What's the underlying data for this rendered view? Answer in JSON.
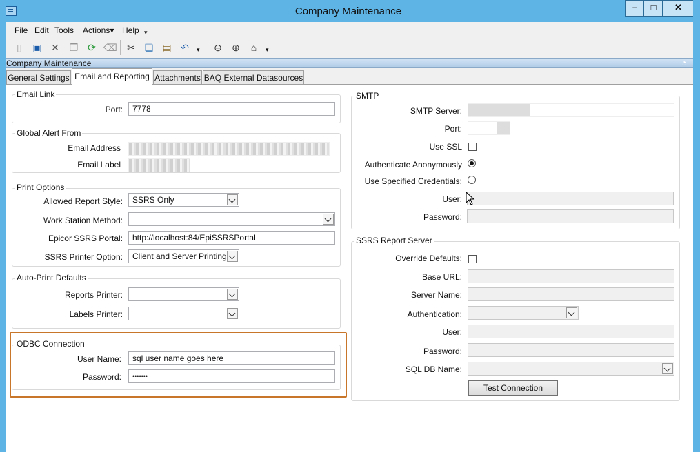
{
  "window": {
    "title": "Company Maintenance",
    "min": "–",
    "max": "□",
    "close": "✕"
  },
  "menu": [
    "File",
    "Edit",
    "Tools",
    "Actions▾",
    "Help"
  ],
  "panel_title": "Company Maintenance",
  "tabs": [
    {
      "label": "General Settings",
      "active": false
    },
    {
      "label": "Email and Reporting",
      "active": true
    },
    {
      "label": "Attachments",
      "active": false
    },
    {
      "label": "BAQ External Datasources",
      "active": false
    }
  ],
  "email_link": {
    "title": "Email Link",
    "port_label": "Port:",
    "port_value": "7778"
  },
  "global_alert": {
    "title": "Global Alert From",
    "address_label": "Email Address",
    "label_label": "Email Label"
  },
  "print_options": {
    "title": "Print Options",
    "style_label": "Allowed Report Style:",
    "style_value": "SSRS Only",
    "ws_label": "Work Station Method:",
    "ws_value": "",
    "portal_label": "Epicor SSRS Portal:",
    "portal_value": "http://localhost:84/EpiSSRSPortal",
    "printer_label": "SSRS Printer Option:",
    "printer_value": "Client and Server Printing"
  },
  "auto_print": {
    "title": "Auto-Print Defaults",
    "reports_label": "Reports Printer:",
    "labels_label": "Labels Printer:"
  },
  "odbc": {
    "title": "ODBC Connection",
    "user_label": "User Name:",
    "user_value": "sql user name goes here",
    "pass_label": "Password:",
    "pass_value": "•••••••"
  },
  "smtp": {
    "title": "SMTP",
    "server_label": "SMTP Server:",
    "port_label": "Port:",
    "ssl_label": "Use SSL",
    "anon_label": "Authenticate Anonymously",
    "creds_label": "Use Specified Credentials:",
    "user_label": "User:",
    "pass_label": "Password:"
  },
  "ssrs": {
    "title": "SSRS Report Server",
    "override_label": "Override Defaults:",
    "base_label": "Base URL:",
    "server_label": "Server Name:",
    "auth_label": "Authentication:",
    "user_label": "User:",
    "pass_label": "Password:",
    "db_label": "SQL DB Name:",
    "test_button": "Test Connection"
  },
  "icons": [
    "new-icon",
    "save-icon",
    "delete-icon",
    "copy-icon",
    "refresh-icon",
    "clear-icon",
    "cut-icon",
    "paste-copy-icon",
    "paste-icon",
    "undo-icon",
    "back-icon",
    "forward-icon",
    "home-icon"
  ],
  "colors": {
    "titlebar": "#5fb4e6",
    "highlight": "#c8762a"
  }
}
